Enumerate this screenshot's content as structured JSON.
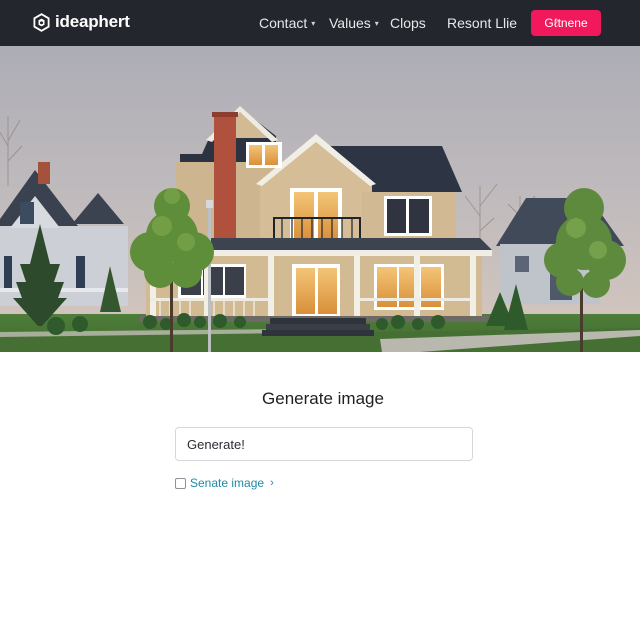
{
  "navbar": {
    "brand": "ideaphert",
    "brand_icon": "hexagon-logo-icon",
    "items": [
      {
        "label": "Contact",
        "has_dropdown": true
      },
      {
        "label": "Values",
        "has_dropdown": true
      },
      {
        "label": "Clops",
        "has_dropdown": false
      },
      {
        "label": "Resont Llie",
        "has_dropdown": false
      }
    ],
    "cta_label": "Gℓtnene"
  },
  "hero": {
    "image_description": "two-story craftsman house with porch at dusk",
    "alt": ""
  },
  "form": {
    "title": "Generate image",
    "prompt_value": "Generate!",
    "prompt_placeholder": "",
    "checkbox_checked": false,
    "checkbox_label": "Senate image",
    "checkbox_chevron": "›"
  },
  "colors": {
    "navbar_bg": "#23262c",
    "accent": "#f2185c",
    "link": "#1f8aa6"
  }
}
